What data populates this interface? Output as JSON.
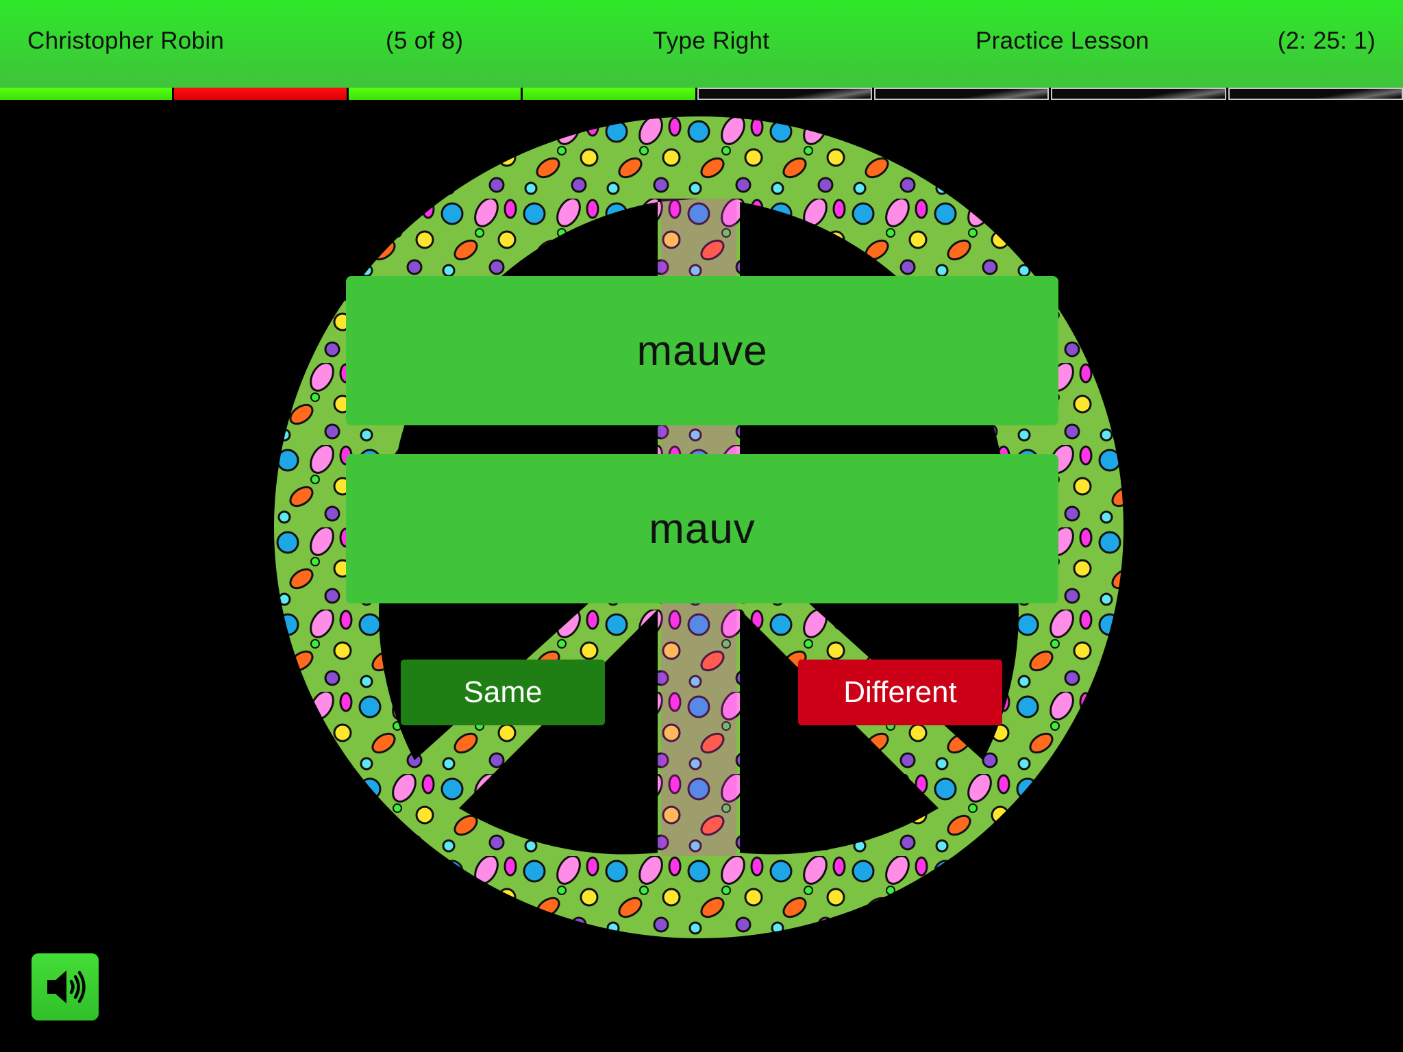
{
  "header": {
    "student_name": "Christopher Robin",
    "item_counter": "(5 of 8)",
    "app_title": "Type Right",
    "lesson_title": "Practice Lesson",
    "timer": "(2: 25: 1)"
  },
  "progress": {
    "total": 8,
    "current": 5,
    "segments": [
      "correct",
      "wrong",
      "correct",
      "correct",
      "pending",
      "pending",
      "pending",
      "pending"
    ]
  },
  "background": {
    "image": "peace-sign-paisley-art"
  },
  "comparison": {
    "target_word": "mauve",
    "typed_word": "mauv"
  },
  "buttons": {
    "same_label": "Same",
    "different_label": "Different"
  },
  "sound": {
    "icon": "speaker-icon"
  },
  "colors": {
    "header_green": "#2fe82a",
    "box_green": "#41c43a",
    "same_green": "#1f7f14",
    "different_red": "#cc0017",
    "progress_correct": "#4cf00d",
    "progress_wrong": "#ee0010"
  }
}
